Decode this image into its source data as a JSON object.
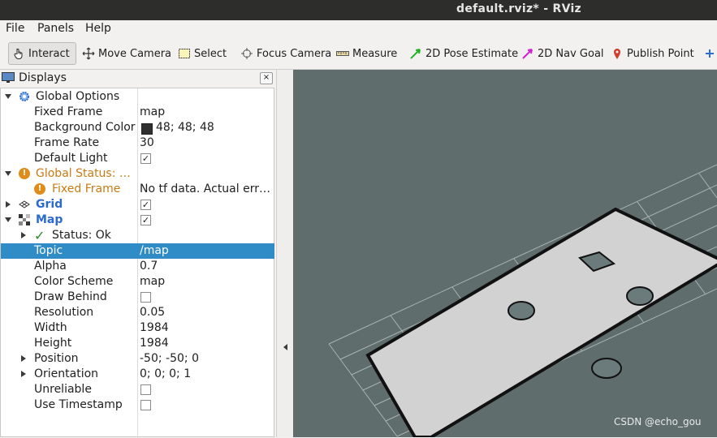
{
  "window": {
    "title": "default.rviz* - RViz"
  },
  "menubar": {
    "file": "File",
    "panels": "Panels",
    "help": "Help"
  },
  "toolbar": {
    "interact": "Interact",
    "move_camera": "Move Camera",
    "select": "Select",
    "focus_camera": "Focus Camera",
    "measure": "Measure",
    "pose_estimate": "2D Pose Estimate",
    "nav_goal": "2D Nav Goal",
    "publish_point": "Publish Point"
  },
  "displays": {
    "title": "Displays",
    "close": "×",
    "global_options": {
      "label": "Global Options",
      "fixed_frame": {
        "key": "Fixed Frame",
        "value": "map"
      },
      "background_color": {
        "key": "Background Color",
        "value": "48; 48; 48",
        "swatch": "#303030"
      },
      "frame_rate": {
        "key": "Frame Rate",
        "value": "30"
      },
      "default_light": {
        "key": "Default Light",
        "checked": true
      }
    },
    "global_status": {
      "label": "Global Status: …",
      "fixed_frame": {
        "key": "Fixed Frame",
        "value": "No tf data.  Actual err…"
      }
    },
    "grid": {
      "label": "Grid",
      "checked": true
    },
    "map": {
      "label": "Map",
      "checked": true,
      "status": "Status: Ok",
      "topic": {
        "key": "Topic",
        "value": "/map"
      },
      "alpha": {
        "key": "Alpha",
        "value": "0.7"
      },
      "color_scheme": {
        "key": "Color Scheme",
        "value": "map"
      },
      "draw_behind": {
        "key": "Draw Behind",
        "checked": false
      },
      "resolution": {
        "key": "Resolution",
        "value": "0.05"
      },
      "width": {
        "key": "Width",
        "value": "1984"
      },
      "height": {
        "key": "Height",
        "value": "1984"
      },
      "position": {
        "key": "Position",
        "value": "-50; -50; 0"
      },
      "orientation": {
        "key": "Orientation",
        "value": "0; 0; 0; 1"
      },
      "unreliable": {
        "key": "Unreliable",
        "checked": false
      },
      "use_timestamp": {
        "key": "Use Timestamp",
        "checked": false
      }
    }
  },
  "colors": {
    "selection": "#308cc6",
    "viewport_bg": "#5f6d6d",
    "map_fill": "#d2d2d2",
    "warning": "#e08c1a"
  },
  "watermark": "CSDN @echo_gou"
}
